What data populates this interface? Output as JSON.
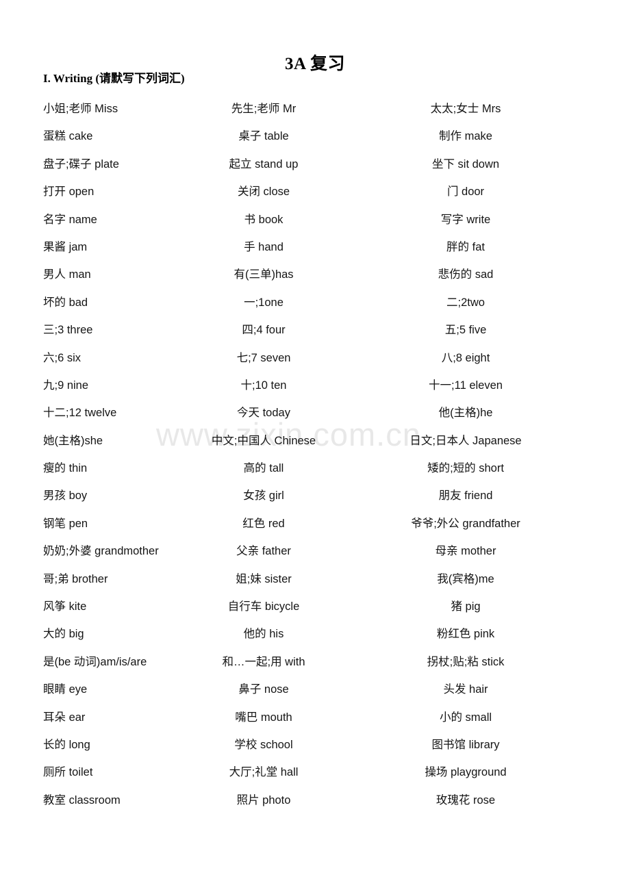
{
  "document": {
    "title": "3A 复习",
    "section_heading": "I. Writing (请默写下列词汇)",
    "watermark": "www.zixin.com.cn"
  },
  "vocabulary": {
    "columns": 3,
    "rows": [
      [
        "小姐;老师  Miss",
        "先生;老师  Mr",
        "太太;女士  Mrs"
      ],
      [
        "蛋糕  cake",
        "桌子 table",
        "制作 make"
      ],
      [
        "盘子;碟子  plate",
        "起立 stand up",
        "坐下 sit down"
      ],
      [
        "打开 open",
        "关闭 close",
        "门 door"
      ],
      [
        "名字 name",
        "书 book",
        "写字 write"
      ],
      [
        "果酱 jam",
        "手 hand",
        "胖的 fat"
      ],
      [
        "男人 man",
        "有(三单)has",
        "悲伤的 sad"
      ],
      [
        "坏的 bad",
        "一;1one",
        "二;2two"
      ],
      [
        "三;3 three",
        "四;4 four",
        "五;5 five"
      ],
      [
        "六;6 six",
        "七;7 seven",
        "八;8 eight"
      ],
      [
        "九;9 nine",
        "十;10 ten",
        "十一;11 eleven"
      ],
      [
        "十二;12 twelve",
        "今天 today",
        "他(主格)he"
      ],
      [
        "她(主格)she",
        "中文;中国人 Chinese",
        "日文;日本人 Japanese"
      ],
      [
        "瘦的 thin",
        "高的 tall",
        "矮的;短的 short"
      ],
      [
        "男孩 boy",
        "女孩 girl",
        "朋友 friend"
      ],
      [
        "钢笔 pen",
        "红色 red",
        "爷爷;外公 grandfather"
      ],
      [
        "奶奶;外婆 grandmother",
        "父亲 father",
        "母亲 mother"
      ],
      [
        "哥;弟 brother",
        "姐;妹 sister",
        "我(宾格)me"
      ],
      [
        "风筝 kite",
        "自行车 bicycle",
        "猪 pig"
      ],
      [
        "大的 big",
        "他的 his",
        "粉红色 pink"
      ],
      [
        "是(be 动词)am/is/are",
        "和…一起;用 with",
        "拐杖;贴;粘 stick"
      ],
      [
        "眼睛 eye",
        "鼻子 nose",
        "头发 hair"
      ],
      [
        "耳朵 ear",
        "嘴巴 mouth",
        "小的 small"
      ],
      [
        "长的 long",
        "学校 school",
        "图书馆 library"
      ],
      [
        "厕所  toilet",
        "大厅;礼堂 hall",
        "操场 playground"
      ],
      [
        "教室 classroom",
        "照片 photo",
        "玫瑰花 rose"
      ]
    ]
  },
  "colors": {
    "page_background": "#ffffff",
    "text": "#151515",
    "watermark": "#e8e8e8"
  }
}
